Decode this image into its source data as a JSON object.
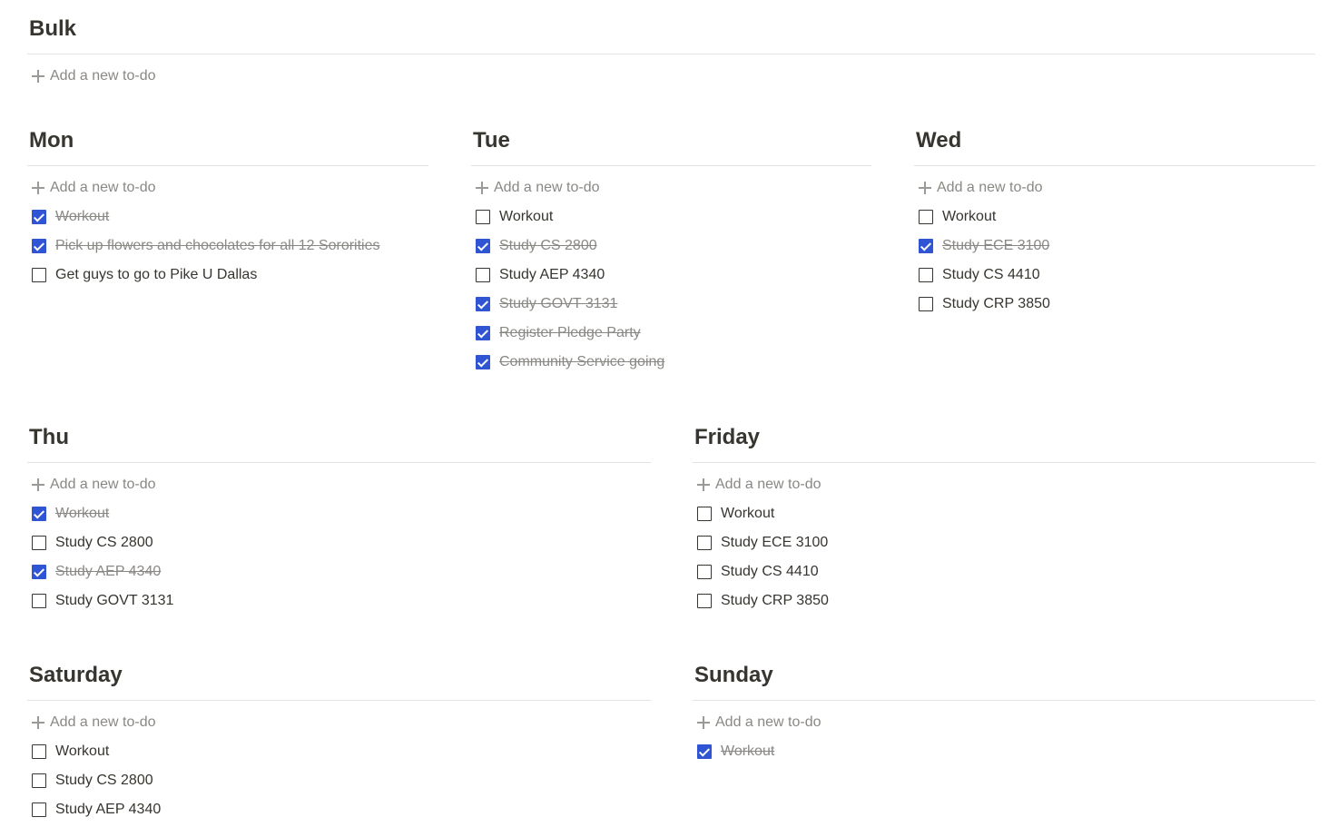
{
  "add_label": "Add a new to-do",
  "colors": {
    "checkbox_checked": "#2f55d4",
    "text": "#37352f",
    "muted": "#8a8884",
    "rule": "#e3e2e0"
  },
  "sections": [
    {
      "title": "Bulk",
      "items": []
    },
    {
      "title": "Mon",
      "items": [
        {
          "label": "Workout",
          "done": true
        },
        {
          "label": "Pick up flowers and chocolates for all 12 Sororities",
          "done": true
        },
        {
          "label": "Get guys to go to Pike U Dallas",
          "done": false
        }
      ]
    },
    {
      "title": "Tue",
      "items": [
        {
          "label": "Workout",
          "done": false
        },
        {
          "label": "Study CS 2800",
          "done": true
        },
        {
          "label": "Study AEP 4340",
          "done": false
        },
        {
          "label": "Study GOVT 3131",
          "done": true
        },
        {
          "label": "Register Pledge Party",
          "done": true
        },
        {
          "label": "Community Service going",
          "done": true
        }
      ]
    },
    {
      "title": "Wed",
      "items": [
        {
          "label": "Workout",
          "done": false
        },
        {
          "label": "Study ECE 3100",
          "done": true
        },
        {
          "label": "Study CS 4410",
          "done": false
        },
        {
          "label": "Study CRP 3850",
          "done": false
        }
      ]
    },
    {
      "title": "Thu",
      "items": [
        {
          "label": "Workout",
          "done": true
        },
        {
          "label": "Study CS 2800",
          "done": false
        },
        {
          "label": "Study AEP 4340",
          "done": true
        },
        {
          "label": "Study GOVT 3131",
          "done": false
        }
      ]
    },
    {
      "title": "Friday",
      "items": [
        {
          "label": "Workout",
          "done": false
        },
        {
          "label": "Study ECE 3100",
          "done": false
        },
        {
          "label": "Study CS 4410",
          "done": false
        },
        {
          "label": "Study CRP 3850",
          "done": false
        }
      ]
    },
    {
      "title": "Saturday",
      "items": [
        {
          "label": "Workout",
          "done": false
        },
        {
          "label": "Study CS 2800",
          "done": false
        },
        {
          "label": "Study AEP 4340",
          "done": false
        }
      ]
    },
    {
      "title": "Sunday",
      "items": [
        {
          "label": "Workout",
          "done": true
        }
      ]
    }
  ]
}
